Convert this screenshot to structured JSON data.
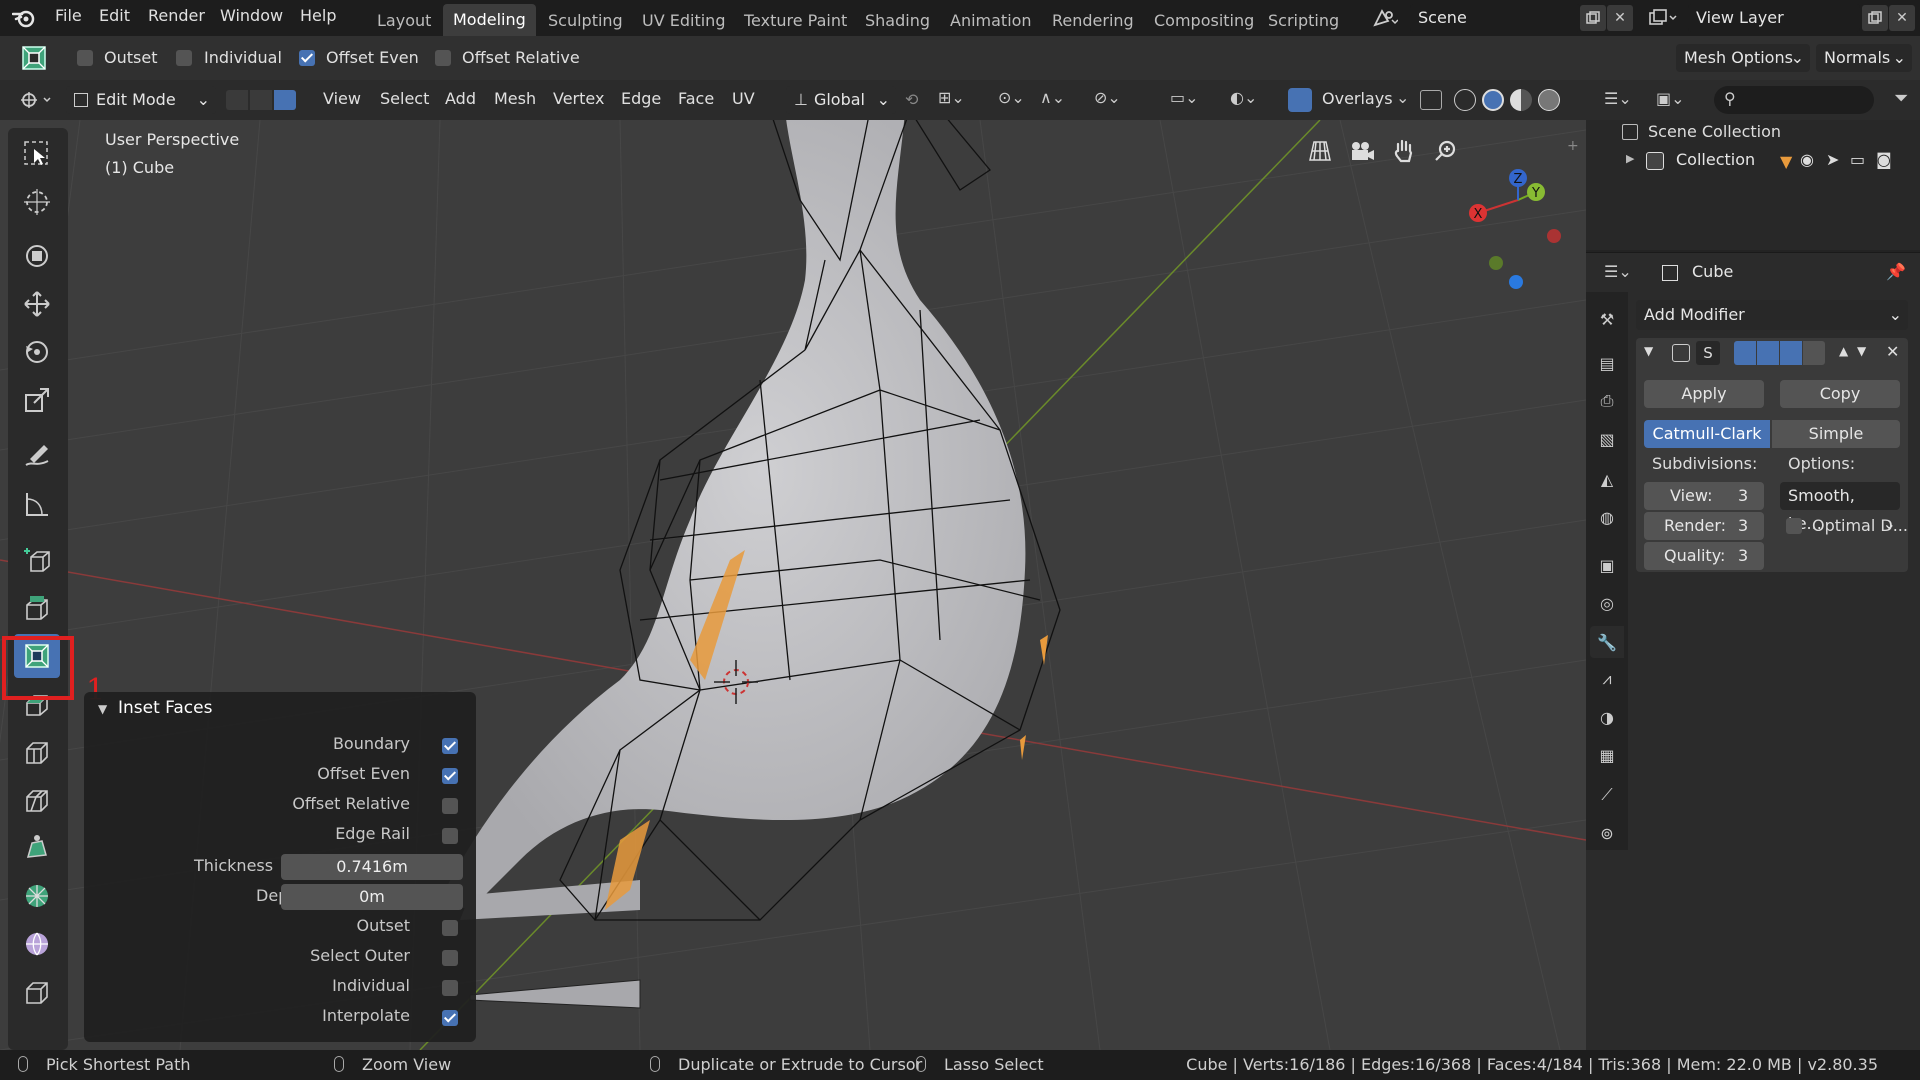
{
  "menu": [
    "File",
    "Edit",
    "Render",
    "Window",
    "Help"
  ],
  "workspaces": [
    "Layout",
    "Modeling",
    "Sculpting",
    "UV Editing",
    "Texture Paint",
    "Shading",
    "Animation",
    "Rendering",
    "Compositing",
    "Scripting"
  ],
  "active_workspace": "Modeling",
  "scene": {
    "name": "Scene"
  },
  "view_layer": {
    "name": "View Layer"
  },
  "tool_settings": {
    "outset": {
      "label": "Outset",
      "checked": false
    },
    "individual": {
      "label": "Individual",
      "checked": false
    },
    "offset_even": {
      "label": "Offset Even",
      "checked": true
    },
    "offset_relative": {
      "label": "Offset Relative",
      "checked": false
    },
    "mesh_options": "Mesh Options",
    "normals": "Normals"
  },
  "viewport_header": {
    "mode": "Edit Mode",
    "menus": [
      "View",
      "Select",
      "Add",
      "Mesh",
      "Vertex",
      "Edge",
      "Face",
      "UV"
    ],
    "orientation": "Global",
    "overlays": "Overlays"
  },
  "viewport": {
    "perspective": "User Perspective",
    "object": "(1) Cube",
    "gizmo_axes": [
      "X",
      "Y",
      "Z"
    ]
  },
  "annotation": {
    "number": "1",
    "color": "#e02020"
  },
  "operator_panel": {
    "title": "Inset Faces",
    "options": [
      {
        "label": "Boundary",
        "checked": true
      },
      {
        "label": "Offset Even",
        "checked": true
      },
      {
        "label": "Offset Relative",
        "checked": false
      },
      {
        "label": "Edge Rail",
        "checked": false
      }
    ],
    "thickness": {
      "label": "Thickness",
      "value": "0.7416m"
    },
    "depth": {
      "label": "Depth",
      "value": "0m"
    },
    "options2": [
      {
        "label": "Outset",
        "checked": false
      },
      {
        "label": "Select Outer",
        "checked": false
      },
      {
        "label": "Individual",
        "checked": false
      },
      {
        "label": "Interpolate",
        "checked": true
      }
    ]
  },
  "outliner": {
    "scene_collection": "Scene Collection",
    "collection": "Collection"
  },
  "properties": {
    "object_name": "Cube",
    "add_modifier": "Add Modifier",
    "modifier_short": "S",
    "apply": "Apply",
    "copy": "Copy",
    "catmull_clark": "Catmull-Clark",
    "simple": "Simple",
    "subdivisions_label": "Subdivisions:",
    "options_label": "Options:",
    "view": {
      "label": "View:",
      "value": "3"
    },
    "render": {
      "label": "Render:",
      "value": "3"
    },
    "quality": {
      "label": "Quality:",
      "value": "3"
    },
    "smooth": "Smooth, ke...",
    "optimal": "Optimal D..."
  },
  "statusbar": {
    "pick_shortest_path": "Pick Shortest Path",
    "zoom_view": "Zoom View",
    "duplicate": "Duplicate or Extrude to Cursor",
    "lasso": "Lasso Select",
    "stats": "Cube | Verts:16/186 | Edges:16/368 | Faces:4/184 | Tris:368 | Mem: 22.0 MB | v2.80.35"
  },
  "colors": {
    "accent": "#4772b3",
    "selected_face": "#e89a3c",
    "highlight": "#e02020"
  }
}
